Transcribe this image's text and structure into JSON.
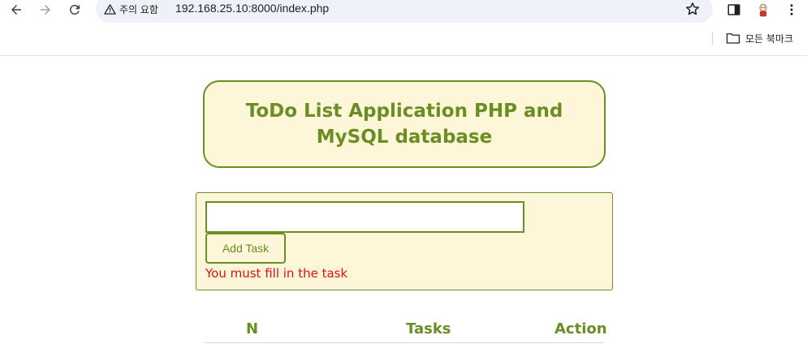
{
  "browser": {
    "security_label": "주의 요함",
    "url": "192.168.25.10:8000/index.php",
    "bookmarks_folder_label": "모든 북마크",
    "icons": [
      "back-arrow-icon",
      "forward-arrow-icon",
      "reload-icon",
      "warning-icon",
      "star-icon",
      "side-panel-icon",
      "profile-avatar-icon",
      "more-menu-icon",
      "folder-icon"
    ]
  },
  "page": {
    "title": "ToDo List Application PHP and MySQL database",
    "form": {
      "task_value": "",
      "add_button_label": "Add Task",
      "error_message": "You must fill in the task"
    },
    "table": {
      "headers": [
        "N",
        "Tasks",
        "Action"
      ]
    }
  },
  "colors": {
    "accent": "#6b8e23",
    "panel_bg": "#fdf6d8",
    "error": "#e01010"
  }
}
